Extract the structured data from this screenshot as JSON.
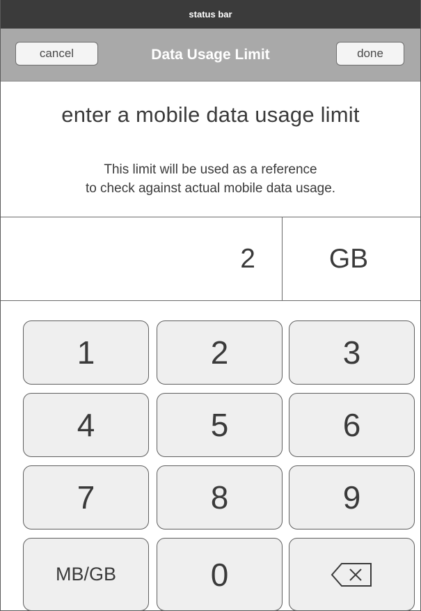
{
  "status_bar": {
    "label": "status bar"
  },
  "nav": {
    "title": "Data Usage Limit",
    "cancel_label": "cancel",
    "done_label": "done"
  },
  "prompt": {
    "title": "enter a mobile data usage limit",
    "description_line1": "This limit will be used as a reference",
    "description_line2": "to check against actual mobile data usage."
  },
  "entry": {
    "value": "2",
    "unit": "GB"
  },
  "keypad": {
    "keys": [
      "1",
      "2",
      "3",
      "4",
      "5",
      "6",
      "7",
      "8",
      "9",
      "MB/GB",
      "0"
    ],
    "backspace_icon": "backspace-icon"
  }
}
